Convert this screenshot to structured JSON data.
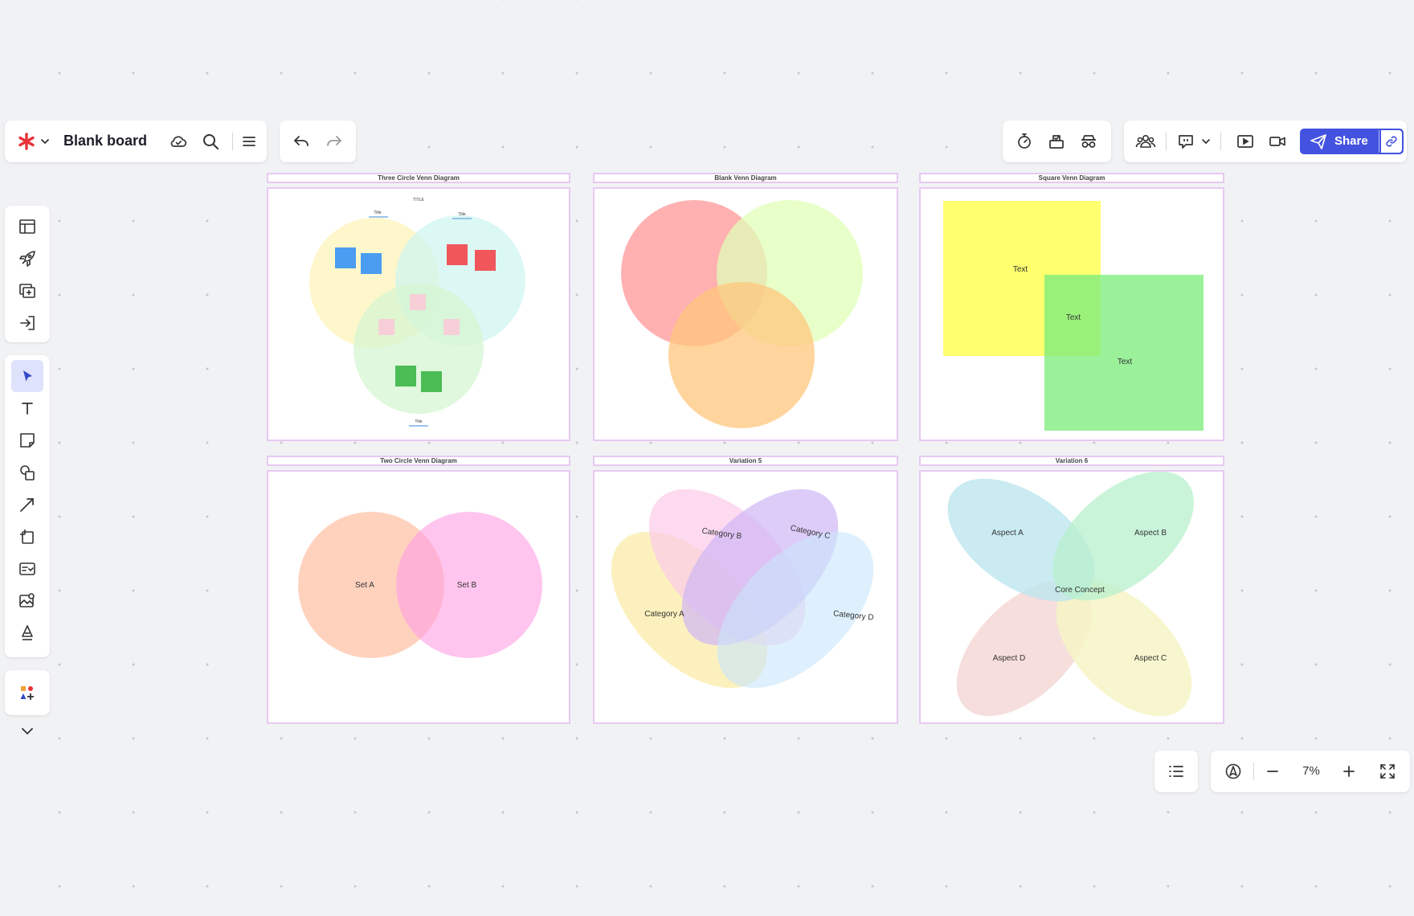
{
  "header": {
    "board_title": "Blank board",
    "share_label": "Share"
  },
  "icons": {
    "brand": "miro-asterisk-icon",
    "cloud": "cloud-check-icon",
    "search": "search-icon",
    "menu": "menu-icon",
    "undo": "undo-icon",
    "redo": "redo-icon",
    "timer": "timer-icon",
    "vote": "vote-icon",
    "private": "private-mode-icon",
    "collaborators": "collaborators-icon",
    "reactions": "reactions-icon",
    "present": "present-icon",
    "video": "video-call-icon",
    "share_link": "link-icon"
  },
  "colors": {
    "accent": "#4353e0",
    "frame_border": "#e8c9f2",
    "brand_red": "#e8333a"
  },
  "zoom": {
    "level": "7%"
  },
  "frames": [
    {
      "title": "Three Circle Venn Diagram",
      "labels": {
        "top": "TITLE",
        "left": "Title",
        "right": "Title",
        "bottom": "Title"
      }
    },
    {
      "title": "Blank Venn Diagram"
    },
    {
      "title": "Square Venn Diagram",
      "labels": {
        "a": "Text",
        "overlap": "Text",
        "b": "Text"
      }
    },
    {
      "title": "Two Circle Venn Diagram",
      "labels": {
        "a": "Set A",
        "b": "Set B"
      }
    },
    {
      "title": "Variation 5",
      "labels": {
        "a": "Category A",
        "b": "Category B",
        "c": "Category C",
        "d": "Category D"
      }
    },
    {
      "title": "Variation 6",
      "labels": {
        "a": "Aspect A",
        "b": "Aspect B",
        "c": "Aspect C",
        "d": "Aspect D",
        "core": "Core Concept"
      }
    }
  ]
}
